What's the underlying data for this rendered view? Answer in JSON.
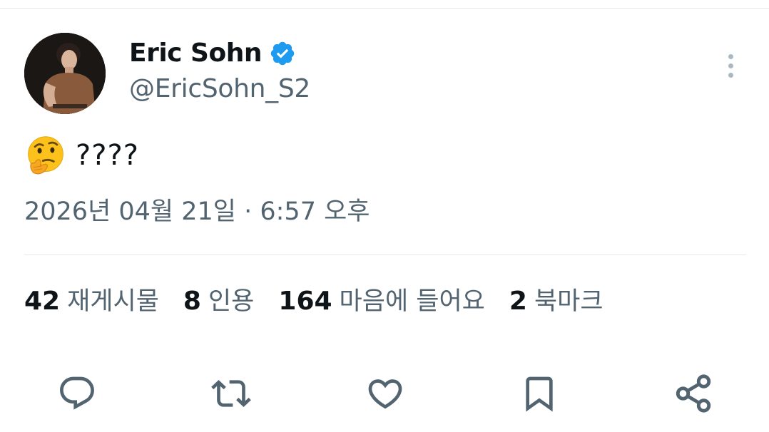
{
  "user": {
    "display_name": "Eric Sohn",
    "handle": "@EricSohn_S2",
    "verified": true,
    "verified_color": "#1d9bf0",
    "avatar": "profile-photo"
  },
  "tweet": {
    "emoji": "🤔",
    "text": "????",
    "timestamp": "2026년 04월 21일 · 6:57 오후"
  },
  "stats": [
    {
      "count": "42",
      "label": "재게시물"
    },
    {
      "count": "8",
      "label": "인용"
    },
    {
      "count": "164",
      "label": "마음에 들어요"
    },
    {
      "count": "2",
      "label": "북마크"
    }
  ],
  "actions": [
    {
      "icon": "reply-icon"
    },
    {
      "icon": "retweet-icon"
    },
    {
      "icon": "like-icon"
    },
    {
      "icon": "bookmark-icon"
    },
    {
      "icon": "share-icon"
    }
  ],
  "colors": {
    "text_primary": "#0f1419",
    "text_secondary": "#536471",
    "divider": "#e6e9ec",
    "icon": "#536471"
  }
}
